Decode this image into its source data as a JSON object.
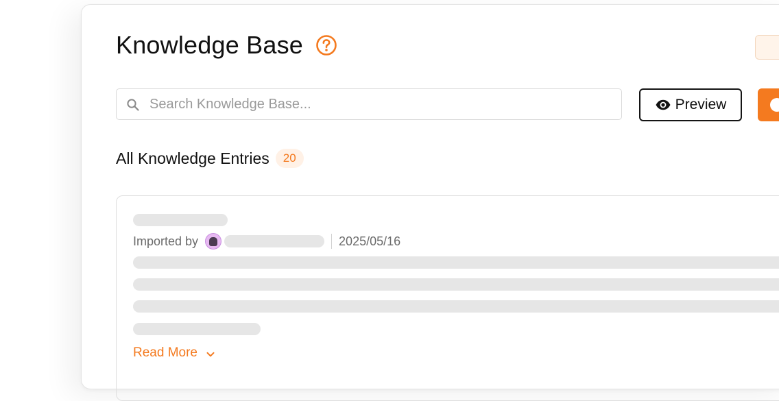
{
  "header": {
    "title": "Knowledge Base",
    "help_icon": "question-circle-icon"
  },
  "search": {
    "placeholder": "Search Knowledge Base...",
    "value": "",
    "icon": "search-icon"
  },
  "toolbar": {
    "preview_label": "Preview",
    "preview_icon": "eye-icon"
  },
  "entries": {
    "title": "All Knowledge Entries",
    "count": "20"
  },
  "entry_card": {
    "imported_by_label": "Imported by",
    "date": "2025/05/16",
    "read_more_label": "Read More",
    "read_more_icon": "chevron-down-icon",
    "avatar_icon": "user-avatar-icon"
  },
  "colors": {
    "accent": "#f47a1f",
    "badge_bg": "#fff1e6",
    "skeleton": "#e6e6e6",
    "avatar_bg": "#e7b9f2"
  }
}
